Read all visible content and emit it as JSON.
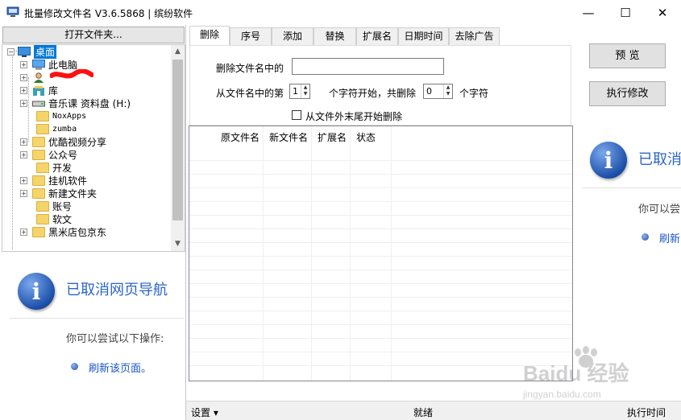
{
  "window": {
    "title": "批量修改文件名 V3.6.5868 | 缤纷软件",
    "minimize_glyph": "—",
    "maximize_glyph": "☐",
    "close_glyph": "✕"
  },
  "left_panel": {
    "open_folder_button": "打开文件夹...",
    "tree": {
      "root": "桌面",
      "items": [
        {
          "label": "此电脑",
          "icon": "computer-icon"
        },
        {
          "label": "",
          "icon": "user-icon"
        },
        {
          "label": "库",
          "icon": "library-icon"
        },
        {
          "label": "音乐课 资料盘 (H:)",
          "icon": "drive-icon"
        },
        {
          "label": "NoxApps",
          "icon": "folder-icon"
        },
        {
          "label": "zumba",
          "icon": "folder-icon"
        },
        {
          "label": "优酷视频分享",
          "icon": "folder-icon"
        },
        {
          "label": "公众号",
          "icon": "folder-icon"
        },
        {
          "label": "开发",
          "icon": "folder-icon"
        },
        {
          "label": "挂机软件",
          "icon": "folder-icon"
        },
        {
          "label": "新建文件夹",
          "icon": "folder-icon"
        },
        {
          "label": "账号",
          "icon": "folder-icon"
        },
        {
          "label": "软文",
          "icon": "folder-icon"
        },
        {
          "label": "黑米店包京东",
          "icon": "folder-icon"
        }
      ]
    },
    "info": {
      "title": "已取消网页导航",
      "subtitle": "你可以尝试以下操作:",
      "link": "刷新该页面。"
    }
  },
  "tabs": [
    "删除",
    "序号",
    "添加",
    "替换",
    "扩展名",
    "日期时间",
    "去除广告"
  ],
  "delete_tab": {
    "label_name_contains": "删除文件名中的",
    "input_name_contains": "",
    "label_from_position": "从文件名中的第",
    "start_value": "1",
    "label_start_chars": "个字符开始，共删除",
    "count_value": "0",
    "label_chars": "个字符",
    "checkbox_from_end": "从文件外末尾开始删除"
  },
  "buttons": {
    "preview": "预  览",
    "execute": "执行修改"
  },
  "grid": {
    "columns": [
      "原文件名",
      "新文件名",
      "扩展名",
      "状态"
    ],
    "rows": []
  },
  "right_info": {
    "title": "已取消",
    "subtitle": "你可以尝",
    "link": "刷新"
  },
  "status": {
    "settings": "设置 ▾",
    "state": "就绪",
    "exec_time": "执行时间"
  },
  "watermark": {
    "brand": "Baidu 经验",
    "url": "jingyan.baidu.com"
  }
}
